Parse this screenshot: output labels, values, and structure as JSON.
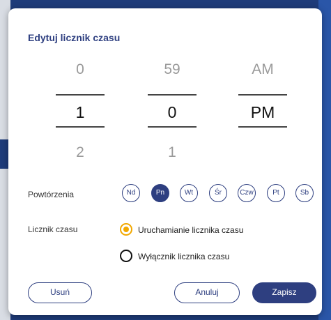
{
  "dialog": {
    "title": "Edytuj licznik czasu"
  },
  "picker": {
    "hour": {
      "prev": "0",
      "selected": "1",
      "next": "2"
    },
    "minute": {
      "prev": "59",
      "selected": "0",
      "next": "1"
    },
    "period": {
      "prev": "AM",
      "selected": "PM"
    }
  },
  "repeat": {
    "label": "Powtórzenia",
    "days": [
      "Nd",
      "Pn",
      "Wt",
      "Śr",
      "Czw",
      "Pt",
      "Sb"
    ],
    "active_day": "Pn"
  },
  "timer": {
    "label": "Licznik czasu",
    "options": [
      {
        "label": "Uruchamianie licznika czasu",
        "selected": true
      },
      {
        "label": "Wyłącznik licznika czasu",
        "selected": false
      }
    ]
  },
  "buttons": {
    "delete": "Usuń",
    "cancel": "Anuluj",
    "save": "Zapisz"
  },
  "colors": {
    "accent": "#2e3f80",
    "radio_selected": "#f2a800",
    "backdrop": "#1f3c7a"
  }
}
